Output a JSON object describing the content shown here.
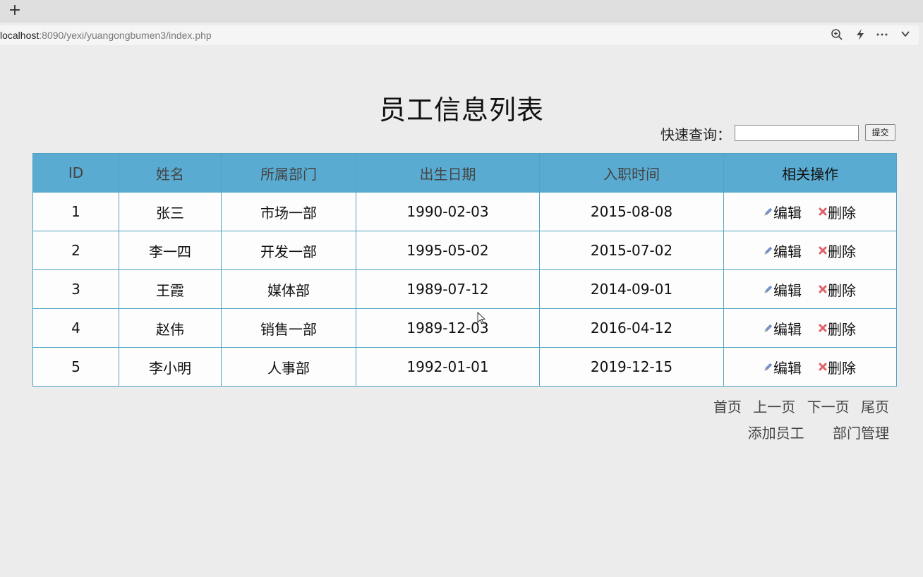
{
  "browser": {
    "new_tab_symbol": "+",
    "url_host": "localhost",
    "url_rest": ":8090/yexi/yuangongbumen3/index.php",
    "toolbar_icons": [
      "zoom-icon",
      "bolt-icon",
      "more-icon",
      "chevron-down-icon"
    ]
  },
  "page": {
    "title": "员工信息列表",
    "quick_search": {
      "label": "快速查询：",
      "value": "",
      "submit_label": "提交"
    }
  },
  "table": {
    "headers": [
      "ID",
      "姓名",
      "所属部门",
      "出生日期",
      "入职时间",
      "相关操作"
    ],
    "rows": [
      {
        "id": "1",
        "name": "张三",
        "dept": "市场一部",
        "birth": "1990-02-03",
        "hired": "2015-08-08"
      },
      {
        "id": "2",
        "name": "李一四",
        "dept": "开发一部",
        "birth": "1995-05-02",
        "hired": "2015-07-02"
      },
      {
        "id": "3",
        "name": "王霞",
        "dept": "媒体部",
        "birth": "1989-07-12",
        "hired": "2014-09-01"
      },
      {
        "id": "4",
        "name": "赵伟",
        "dept": "销售一部",
        "birth": "1989-12-03",
        "hired": "2016-04-12"
      },
      {
        "id": "5",
        "name": "李小明",
        "dept": "人事部",
        "birth": "1992-01-01",
        "hired": "2019-12-15"
      }
    ],
    "edit_label": "编辑",
    "delete_label": "删除",
    "colors": {
      "header_bg": "#5aabd1",
      "border": "#4fa3c4",
      "delete_icon": "#e0606a",
      "edit_icon": "#5b7fbf"
    }
  },
  "pager": {
    "first": "首页",
    "prev": "上一页",
    "next": "下一页",
    "last": "尾页"
  },
  "links": {
    "add_employee": "添加员工",
    "dept_manage": "部门管理"
  }
}
